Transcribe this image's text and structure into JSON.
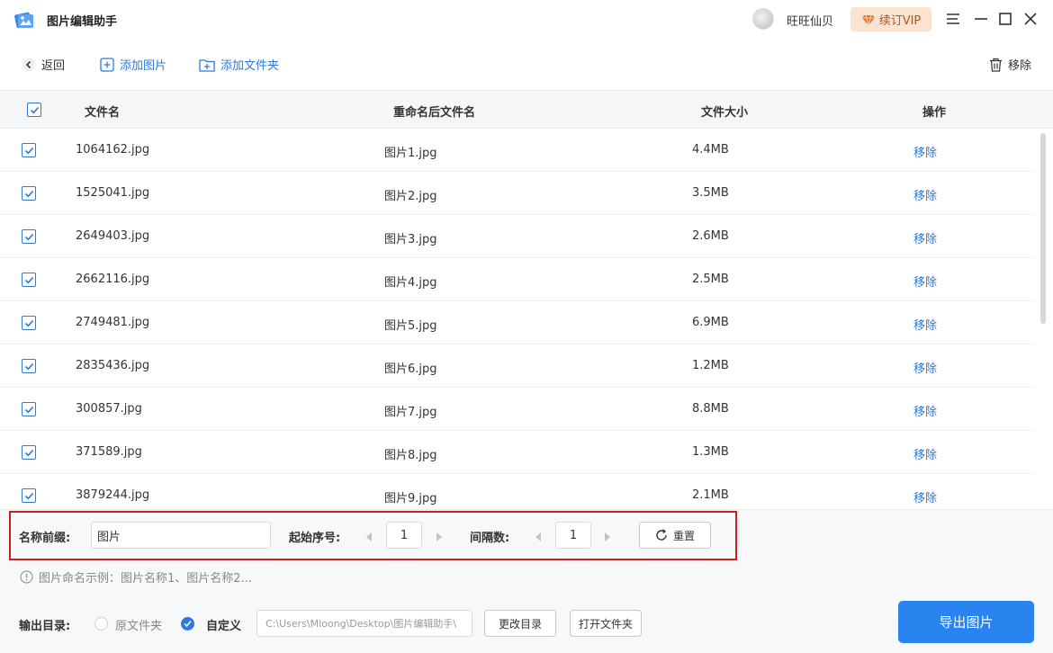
{
  "titlebar": {
    "app_title": "图片编辑助手",
    "username": "旺旺仙贝",
    "vip_label": "续订VIP"
  },
  "toolbar": {
    "back_label": "返回",
    "add_image_label": "添加图片",
    "add_folder_label": "添加文件夹",
    "remove_label": "移除"
  },
  "table": {
    "headers": [
      "文件名",
      "重命名后文件名",
      "文件大小",
      "操作"
    ],
    "rows": [
      {
        "name": "1064162.jpg",
        "renamed": "图片1.jpg",
        "size": "4.4MB",
        "action": "移除"
      },
      {
        "name": "1525041.jpg",
        "renamed": "图片2.jpg",
        "size": "3.5MB",
        "action": "移除"
      },
      {
        "name": "2649403.jpg",
        "renamed": "图片3.jpg",
        "size": "2.6MB",
        "action": "移除"
      },
      {
        "name": "2662116.jpg",
        "renamed": "图片4.jpg",
        "size": "2.5MB",
        "action": "移除"
      },
      {
        "name": "2749481.jpg",
        "renamed": "图片5.jpg",
        "size": "6.9MB",
        "action": "移除"
      },
      {
        "name": "2835436.jpg",
        "renamed": "图片6.jpg",
        "size": "1.2MB",
        "action": "移除"
      },
      {
        "name": "300857.jpg",
        "renamed": "图片7.jpg",
        "size": "8.8MB",
        "action": "移除"
      },
      {
        "name": "371589.jpg",
        "renamed": "图片8.jpg",
        "size": "1.3MB",
        "action": "移除"
      },
      {
        "name": "3879244.jpg",
        "renamed": "图片9.jpg",
        "size": "2.1MB",
        "action": "移除"
      }
    ]
  },
  "settings": {
    "prefix_label": "名称前缀:",
    "prefix_value": "图片",
    "start_label": "起始序号:",
    "start_value": "1",
    "interval_label": "间隔数:",
    "interval_value": "1",
    "reset_label": "重置",
    "hint": "图片命名示例：图片名称1、图片名称2...",
    "output_label": "输出目录:",
    "option_original": "原文件夹",
    "option_custom": "自定义",
    "path": "C:\\Users\\Mloong\\Desktop\\图片编辑助手\\",
    "change_dir_label": "更改目录",
    "open_folder_label": "打开文件夹",
    "export_label": "导出图片"
  }
}
